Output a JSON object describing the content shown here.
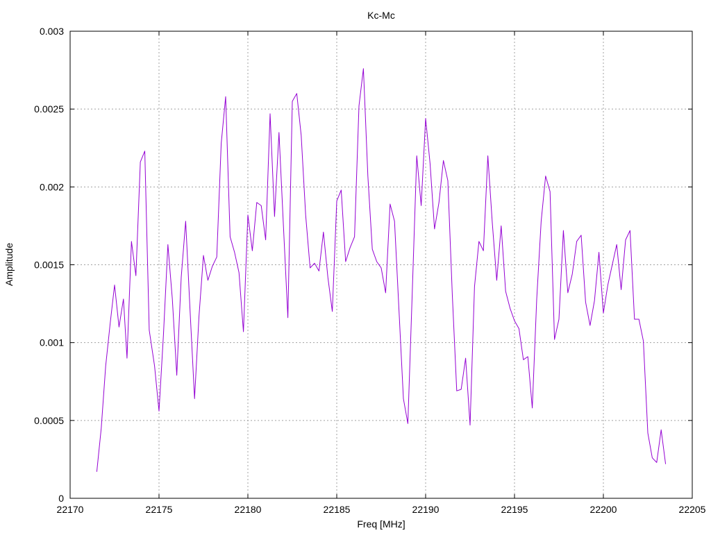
{
  "chart_data": {
    "type": "line",
    "title": "Kc-Mc",
    "xlabel": "Freq [MHz]",
    "ylabel": "Amplitude",
    "xlim": [
      22170,
      22205
    ],
    "ylim": [
      0,
      0.003
    ],
    "xticks": [
      22170,
      22175,
      22180,
      22185,
      22190,
      22195,
      22200,
      22205
    ],
    "yticks": [
      0,
      0.0005,
      0.001,
      0.0015,
      0.002,
      0.0025,
      0.003
    ],
    "xtick_labels": [
      "22170",
      "22175",
      "22180",
      "22185",
      "22190",
      "22195",
      "22200",
      "22205"
    ],
    "ytick_labels": [
      "0",
      "0.0005",
      "0.001",
      "0.0015",
      "0.002",
      "0.0025",
      "0.003"
    ],
    "grid": true,
    "legend": "none",
    "series": [
      {
        "color": "#9400d3",
        "points": [
          [
            22171.5,
            0.00017
          ],
          [
            22171.75,
            0.00045
          ],
          [
            22172.0,
            0.00085
          ],
          [
            22172.25,
            0.00112
          ],
          [
            22172.5,
            0.00137
          ],
          [
            22172.75,
            0.0011
          ],
          [
            22173.0,
            0.00128
          ],
          [
            22173.2,
            0.0009
          ],
          [
            22173.45,
            0.00165
          ],
          [
            22173.7,
            0.00143
          ],
          [
            22173.95,
            0.00216
          ],
          [
            22174.2,
            0.00223
          ],
          [
            22174.45,
            0.00108
          ],
          [
            22174.75,
            0.00085
          ],
          [
            22175.0,
            0.00056
          ],
          [
            22175.25,
            0.00105
          ],
          [
            22175.5,
            0.00163
          ],
          [
            22175.75,
            0.00128
          ],
          [
            22176.0,
            0.00079
          ],
          [
            22176.25,
            0.00142
          ],
          [
            22176.5,
            0.00178
          ],
          [
            22176.75,
            0.0012
          ],
          [
            22177.0,
            0.00064
          ],
          [
            22177.25,
            0.00117
          ],
          [
            22177.5,
            0.00156
          ],
          [
            22177.75,
            0.0014
          ],
          [
            22178.0,
            0.00149
          ],
          [
            22178.25,
            0.00155
          ],
          [
            22178.5,
            0.00228
          ],
          [
            22178.75,
            0.00258
          ],
          [
            22179.0,
            0.00168
          ],
          [
            22179.25,
            0.00158
          ],
          [
            22179.5,
            0.00145
          ],
          [
            22179.75,
            0.00107
          ],
          [
            22180.0,
            0.00182
          ],
          [
            22180.25,
            0.00159
          ],
          [
            22180.5,
            0.0019
          ],
          [
            22180.75,
            0.00188
          ],
          [
            22181.0,
            0.00166
          ],
          [
            22181.25,
            0.00247
          ],
          [
            22181.5,
            0.00181
          ],
          [
            22181.75,
            0.00235
          ],
          [
            22182.0,
            0.00175
          ],
          [
            22182.25,
            0.00116
          ],
          [
            22182.5,
            0.00255
          ],
          [
            22182.75,
            0.0026
          ],
          [
            22183.0,
            0.00233
          ],
          [
            22183.25,
            0.00182
          ],
          [
            22183.5,
            0.00148
          ],
          [
            22183.75,
            0.00151
          ],
          [
            22184.0,
            0.00146
          ],
          [
            22184.25,
            0.00171
          ],
          [
            22184.5,
            0.00142
          ],
          [
            22184.75,
            0.0012
          ],
          [
            22185.0,
            0.00191
          ],
          [
            22185.25,
            0.00198
          ],
          [
            22185.5,
            0.00152
          ],
          [
            22185.75,
            0.00161
          ],
          [
            22186.0,
            0.00168
          ],
          [
            22186.25,
            0.00252
          ],
          [
            22186.5,
            0.00276
          ],
          [
            22186.75,
            0.00207
          ],
          [
            22187.0,
            0.0016
          ],
          [
            22187.25,
            0.00152
          ],
          [
            22187.5,
            0.00148
          ],
          [
            22187.75,
            0.00132
          ],
          [
            22188.0,
            0.00189
          ],
          [
            22188.25,
            0.00178
          ],
          [
            22188.5,
            0.00121
          ],
          [
            22188.75,
            0.00064
          ],
          [
            22189.0,
            0.00048
          ],
          [
            22189.25,
            0.00133
          ],
          [
            22189.5,
            0.0022
          ],
          [
            22189.75,
            0.00188
          ],
          [
            22190.0,
            0.00244
          ],
          [
            22190.25,
            0.00215
          ],
          [
            22190.5,
            0.00173
          ],
          [
            22190.75,
            0.0019
          ],
          [
            22191.0,
            0.00217
          ],
          [
            22191.25,
            0.00204
          ],
          [
            22191.5,
            0.00131
          ],
          [
            22191.75,
            0.00069
          ],
          [
            22192.0,
            0.0007
          ],
          [
            22192.25,
            0.0009
          ],
          [
            22192.5,
            0.00047
          ],
          [
            22192.75,
            0.00136
          ],
          [
            22193.0,
            0.00165
          ],
          [
            22193.25,
            0.00159
          ],
          [
            22193.5,
            0.0022
          ],
          [
            22193.75,
            0.00177
          ],
          [
            22194.0,
            0.0014
          ],
          [
            22194.25,
            0.00175
          ],
          [
            22194.5,
            0.00133
          ],
          [
            22194.75,
            0.00122
          ],
          [
            22195.0,
            0.00114
          ],
          [
            22195.25,
            0.00109
          ],
          [
            22195.5,
            0.00089
          ],
          [
            22195.75,
            0.00091
          ],
          [
            22196.0,
            0.00058
          ],
          [
            22196.25,
            0.00128
          ],
          [
            22196.5,
            0.00178
          ],
          [
            22196.75,
            0.00207
          ],
          [
            22197.0,
            0.00197
          ],
          [
            22197.25,
            0.00102
          ],
          [
            22197.5,
            0.00115
          ],
          [
            22197.75,
            0.00172
          ],
          [
            22198.0,
            0.00132
          ],
          [
            22198.25,
            0.00144
          ],
          [
            22198.5,
            0.00165
          ],
          [
            22198.75,
            0.00169
          ],
          [
            22199.0,
            0.00126
          ],
          [
            22199.25,
            0.00111
          ],
          [
            22199.5,
            0.00127
          ],
          [
            22199.75,
            0.00158
          ],
          [
            22200.0,
            0.00119
          ],
          [
            22200.25,
            0.00137
          ],
          [
            22200.5,
            0.0015
          ],
          [
            22200.75,
            0.00163
          ],
          [
            22201.0,
            0.00134
          ],
          [
            22201.25,
            0.00166
          ],
          [
            22201.5,
            0.00172
          ],
          [
            22201.75,
            0.00115
          ],
          [
            22202.0,
            0.00115
          ],
          [
            22202.25,
            0.00101
          ],
          [
            22202.5,
            0.00042
          ],
          [
            22202.75,
            0.00026
          ],
          [
            22203.0,
            0.00023
          ],
          [
            22203.25,
            0.00044
          ],
          [
            22203.5,
            0.00022
          ]
        ]
      }
    ]
  }
}
